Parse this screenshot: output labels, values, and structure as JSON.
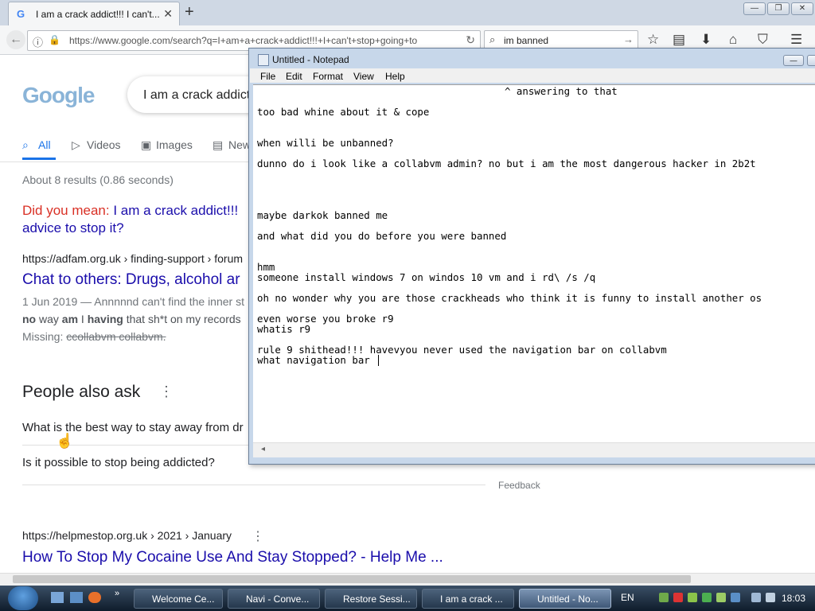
{
  "browser": {
    "tab_title": "I am a crack addict!!! I can't...",
    "new_tab": "+",
    "url": "https://www.google.com/search?q=I+am+a+crack+addict!!!+I+can't+stop+going+to",
    "search_value": "im banned"
  },
  "google": {
    "logo_text": "Google",
    "query": "I am a crack addict",
    "tabs": [
      "All",
      "Videos",
      "Images",
      "New"
    ],
    "stats": "About 8 results (0.86 seconds)",
    "did_you_mean_label": "Did you mean:",
    "did_you_mean_link": "I am a crack addict!!!",
    "did_you_mean_link2": "advice to stop it?",
    "result1": {
      "breadcrumb": "https://adfam.org.uk › finding-support › forum",
      "title": "Chat to others: Drugs, alcohol ar",
      "snippet1": "1 Jun 2019 — Annnnnd can't find the inner st",
      "snippet2_b1": "no",
      "snippet2_t1": " way ",
      "snippet2_b2": "am",
      "snippet2_t2": " I ",
      "snippet2_b3": "having",
      "snippet2_t3": " that sh*t on my records",
      "missing_label": "Missing: ",
      "missing_terms": "ccollabvm collabvm."
    },
    "paa_title": "People also ask",
    "paa_q1": "What is the best way to stay away from dr",
    "paa_q2": "Is it possible to stop being addicted?",
    "feedback": "Feedback",
    "result2": {
      "breadcrumb": "https://helpmestop.org.uk › 2021 › January",
      "title": "How To Stop My Cocaine Use And Stay Stopped? - Help Me ..."
    }
  },
  "notepad": {
    "title": "Untitled - Notepad",
    "menu": [
      "File",
      "Edit",
      "Format",
      "View",
      "Help"
    ],
    "lines": [
      "^ answering to that",
      "too bad whine about it & cope",
      "when willi be unbanned?",
      "dunno do i look like a collabvm admin? no but i am the most dangerous hacker in 2b2t",
      "maybe darkok banned me",
      "and what did you do before you were banned",
      "hmm",
      "someone install windows 7 on windos 10 vm and i rd\\ /s /q",
      "oh no wonder why you are those crackheads who think it is funny to install another os",
      "even worse you broke r9",
      "whatis r9",
      "rule 9 shithead!!! havevyou never used the navigation bar on collabvm",
      "what navigation bar"
    ]
  },
  "taskbar": {
    "items": [
      "Welcome Ce...",
      "Navi - Conve...",
      "Restore Sessi...",
      "I am a crack ...",
      "Untitled - No..."
    ],
    "lang": "EN",
    "clock": "18:03"
  }
}
